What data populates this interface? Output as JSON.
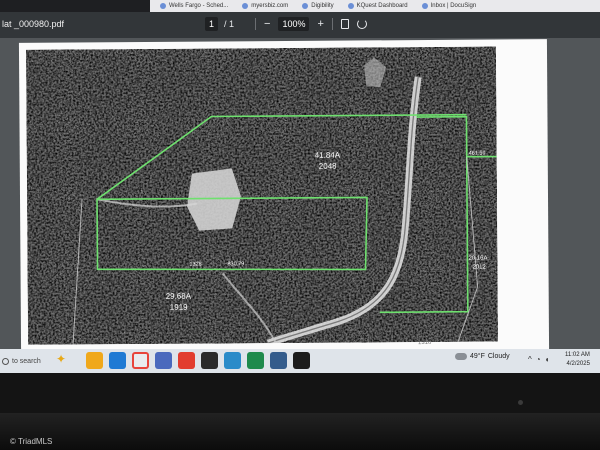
{
  "browser": {
    "bookmarks": [
      "Wells Fargo - Sched...",
      "myersbiz.com",
      "Digibility",
      "KQuest Dashboard",
      "Inbox | DocuSign"
    ]
  },
  "pdf_viewer": {
    "file_title": "lat _000980.pdf",
    "page_current": "1",
    "page_total": "/ 1",
    "zoom_out_symbol": "−",
    "zoom_level": "100%",
    "zoom_in_symbol": "+",
    "fit_icon": "fit-page-icon",
    "rotate_icon": "rotate-icon"
  },
  "plat": {
    "tract_north": {
      "acres": "41.84A",
      "number": "2048"
    },
    "tract_south": {
      "acres": "29.68A",
      "number": "1919"
    },
    "parcel_right": {
      "acres": "20.16A",
      "number": "2012"
    },
    "labels": {
      "right_dim": "461.59",
      "center_dim": "830.79",
      "bottom_dim": "1328",
      "lower_right": "1316"
    },
    "boundary_color": "#6fe06f"
  },
  "taskbar": {
    "search_text": "to search",
    "weather_temp": "49°F",
    "weather_text": "Cloudy",
    "time": "11:02 AM",
    "date": "4/2/2025"
  },
  "watermark": "© TriadMLS"
}
